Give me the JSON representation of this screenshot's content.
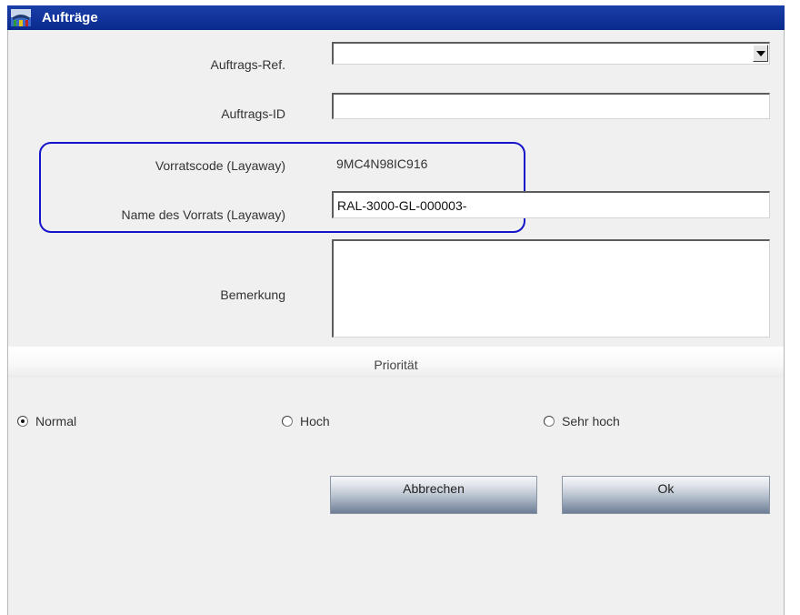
{
  "window": {
    "title": "Aufträge"
  },
  "form": {
    "auftrags_ref": {
      "label": "Auftrags-Ref.",
      "value": ""
    },
    "auftrags_id": {
      "label": "Auftrags-ID",
      "value": ""
    },
    "vorratscode": {
      "label": "Vorratscode (Layaway)",
      "value": "9MC4N98IC916"
    },
    "vorrat_name": {
      "label": "Name des Vorrats (Layaway)",
      "value": "RAL-3000-GL-000003-"
    },
    "bemerkung": {
      "label": "Bemerkung",
      "value": ""
    }
  },
  "priority": {
    "heading": "Priorität",
    "options": [
      {
        "label": "Normal",
        "selected": true
      },
      {
        "label": "Hoch",
        "selected": false
      },
      {
        "label": "Sehr hoch",
        "selected": false
      }
    ]
  },
  "buttons": {
    "cancel": "Abbrechen",
    "ok": "Ok"
  },
  "colors": {
    "titlebar": "#0a2a8e",
    "highlight": "#1414c8",
    "background": "#f0f0f0"
  }
}
